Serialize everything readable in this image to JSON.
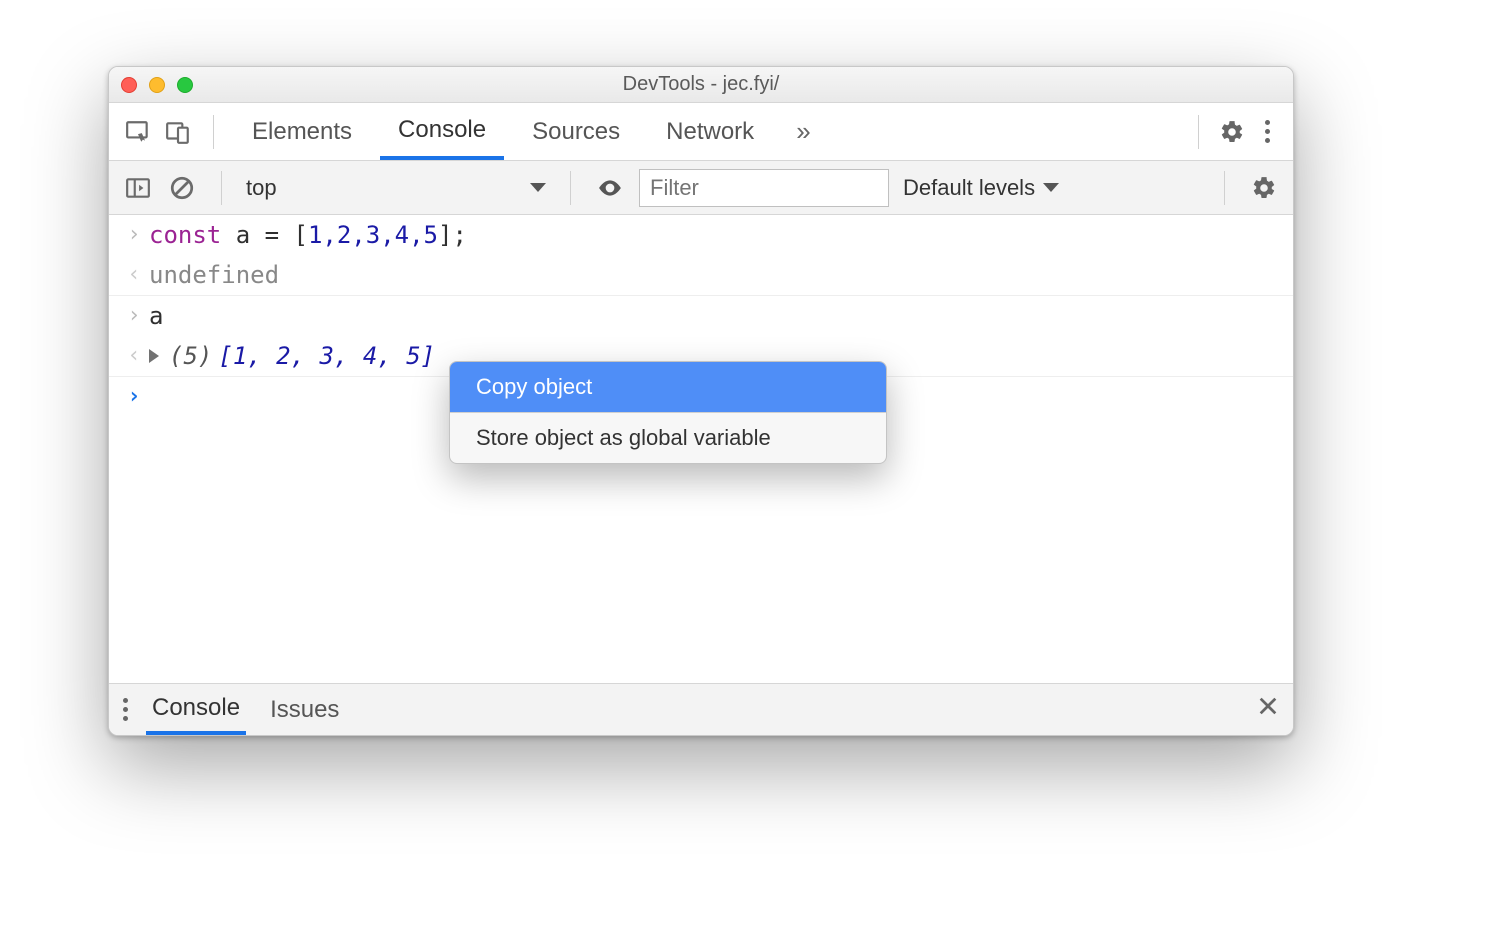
{
  "window": {
    "title": "DevTools - jec.fyi/"
  },
  "tabs": {
    "elements": "Elements",
    "console": "Console",
    "sources": "Sources",
    "network": "Network"
  },
  "toolbar": {
    "context": "top",
    "filter_placeholder": "Filter",
    "levels": "Default levels"
  },
  "console": {
    "input1_kw": "const",
    "input1_rest": " a = [",
    "input1_nums": "1,2,3,4,5",
    "input1_end": "];",
    "out1": "undefined",
    "input2": "a",
    "out2_count": "(5) ",
    "out2_open": "[",
    "out2_vals": "1, 2, 3, 4, 5",
    "out2_close": "]"
  },
  "contextmenu": {
    "copy": "Copy object",
    "store": "Store object as global variable"
  },
  "drawer": {
    "console": "Console",
    "issues": "Issues"
  }
}
